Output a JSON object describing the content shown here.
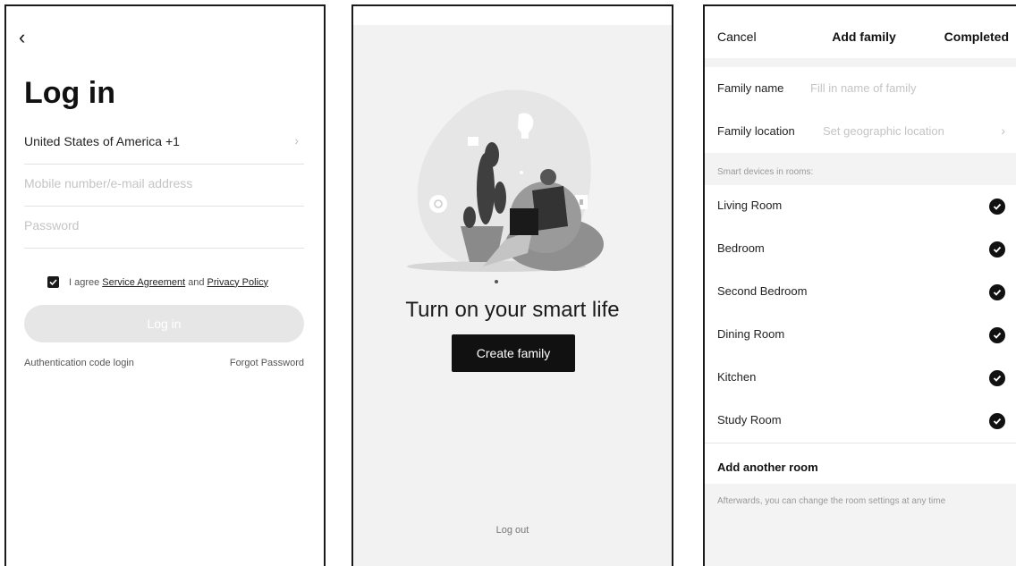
{
  "login": {
    "title": "Log in",
    "country": "United States of America +1",
    "mobile_placeholder": "Mobile number/e-mail address",
    "password_placeholder": "Password",
    "agree_prefix": "I agree",
    "service_agreement": "Service Agreement",
    "and": "and",
    "privacy_policy": "Privacy Policy",
    "login_button": "Log in",
    "auth_code_login": "Authentication code login",
    "forgot_password": "Forgot Password"
  },
  "welcome": {
    "headline": "Turn on your smart life",
    "create_family": "Create family",
    "log_out": "Log out"
  },
  "add_family": {
    "cancel": "Cancel",
    "title": "Add family",
    "completed": "Completed",
    "family_name_label": "Family name",
    "family_name_placeholder": "Fill in name of family",
    "family_location_label": "Family location",
    "family_location_placeholder": "Set geographic location",
    "section_title": "Smart devices in rooms:",
    "rooms": [
      "Living Room",
      "Bedroom",
      "Second Bedroom",
      "Dining Room",
      "Kitchen",
      "Study Room"
    ],
    "add_another_room": "Add another room",
    "note": "Afterwards, you can change the room settings at any time"
  }
}
